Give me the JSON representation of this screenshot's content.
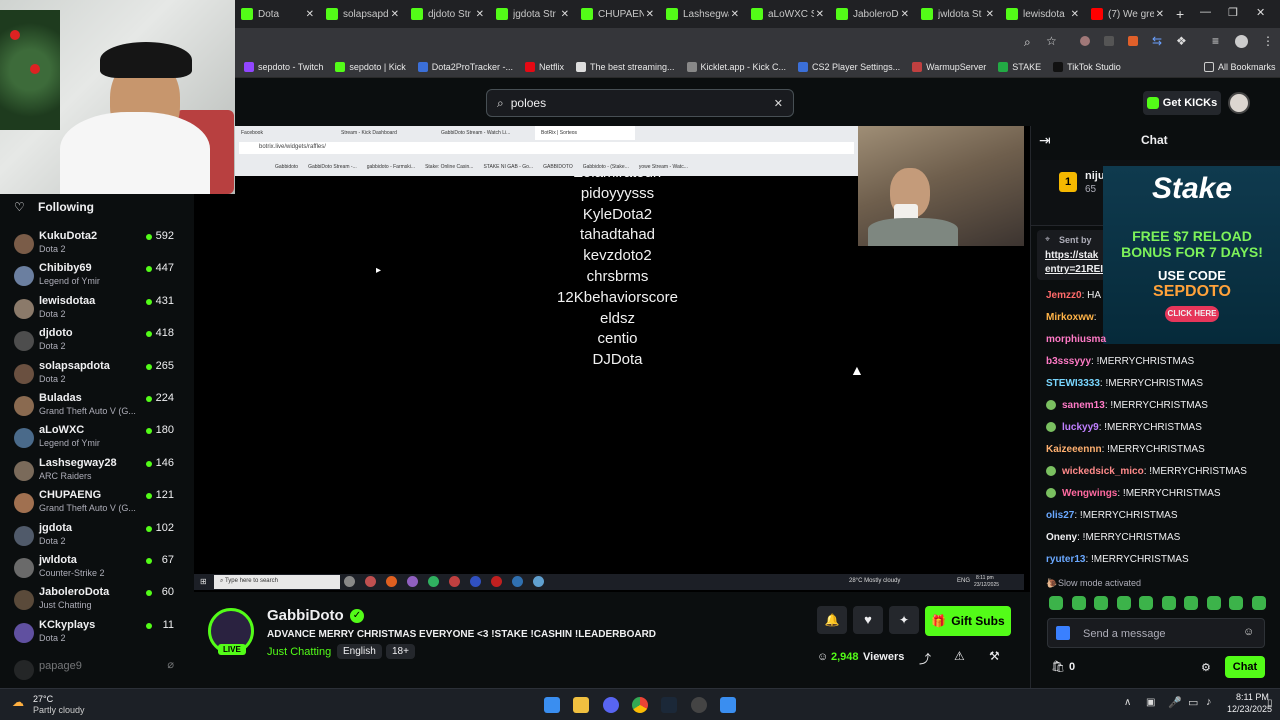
{
  "browser": {
    "tabs": [
      {
        "label": "Dota",
        "color": "#53fc18"
      },
      {
        "label": "solapsapd",
        "color": "#53fc18"
      },
      {
        "label": "djdoto Str",
        "color": "#53fc18"
      },
      {
        "label": "jgdota Str",
        "color": "#53fc18"
      },
      {
        "label": "CHUPAEN",
        "color": "#53fc18"
      },
      {
        "label": "Lashsegwa",
        "color": "#53fc18"
      },
      {
        "label": "aLoWXC S",
        "color": "#53fc18"
      },
      {
        "label": "JaboleroD",
        "color": "#53fc18"
      },
      {
        "label": "jwldota St",
        "color": "#53fc18"
      },
      {
        "label": "lewisdota",
        "color": "#53fc18"
      },
      {
        "label": "(7) We gre",
        "color": "#ff0000"
      }
    ],
    "new_tab": "+",
    "bookmarks": [
      {
        "label": "sepdoto - Twitch",
        "color": "#9146ff"
      },
      {
        "label": "sepdoto | Kick",
        "color": "#53fc18"
      },
      {
        "label": "Dota2ProTracker -...",
        "color": "#3b6fd8"
      },
      {
        "label": "Netflix",
        "color": "#e50914"
      },
      {
        "label": "The best streaming...",
        "color": "#dddddd"
      },
      {
        "label": "Kicklet.app - Kick C...",
        "color": "#888888"
      },
      {
        "label": "CS2 Player Settings...",
        "color": "#3b6fd8"
      },
      {
        "label": "WarmupServer",
        "color": "#c04040"
      },
      {
        "label": "STAKE",
        "color": "#22aa44"
      },
      {
        "label": "TikTok Studio",
        "color": "#111111"
      }
    ],
    "all_bookmarks": "All Bookmarks"
  },
  "header": {
    "search_value": "poloes",
    "get_kicks": "Get KICKs"
  },
  "sidebar": {
    "title": "Following",
    "channels": [
      {
        "name": "KukuDota2",
        "game": "Dota 2",
        "viewers": "592",
        "color": "#7a5c48"
      },
      {
        "name": "Chibiby69",
        "game": "Legend of Ymir",
        "viewers": "447",
        "color": "#6b7fa0"
      },
      {
        "name": "lewisdotaa",
        "game": "Dota 2",
        "viewers": "431",
        "color": "#8b7a6a"
      },
      {
        "name": "djdoto",
        "game": "Dota 2",
        "viewers": "418",
        "color": "#4d4d4d"
      },
      {
        "name": "solapsapdota",
        "game": "Dota 2",
        "viewers": "265",
        "color": "#6a5040"
      },
      {
        "name": "Buladas",
        "game": "Grand Theft Auto V (G...",
        "viewers": "224",
        "color": "#8a6a50"
      },
      {
        "name": "aLoWXC",
        "game": "Legend of Ymir",
        "viewers": "180",
        "color": "#4a6a8a"
      },
      {
        "name": "Lashsegway28",
        "game": "ARC Raiders",
        "viewers": "146",
        "color": "#7a6a5a"
      },
      {
        "name": "CHUPAENG",
        "game": "Grand Theft Auto V (G...",
        "viewers": "121",
        "color": "#a07050"
      },
      {
        "name": "jgdota",
        "game": "Dota 2",
        "viewers": "102",
        "color": "#505a6a"
      },
      {
        "name": "jwldota",
        "game": "Counter-Strike 2",
        "viewers": "67",
        "color": "#6a6a6a"
      },
      {
        "name": "JaboleroDota",
        "game": "Just Chatting",
        "viewers": "60",
        "color": "#5a4a3a"
      },
      {
        "name": "KCkyplays",
        "game": "Dota 2",
        "viewers": "11",
        "color": "#6050a0"
      }
    ],
    "offline_name": "papage9"
  },
  "player": {
    "inner_tabs": [
      "Facebook",
      "Stream - Kick Dashboard",
      "GabbiDoto Stream - Watch Li...",
      "BotRix | Sorteos"
    ],
    "inner_url": "botrix.live/widgets/raffles/",
    "inner_bookmarks": [
      "Gabbidoto",
      "GabbiDoto Stream -...",
      "gabbidoto - Farmski...",
      "Stake: Online Casin...",
      "STAKE NI GAB - Go...",
      "GABBIDOTO",
      "Gabbidoto - (Stake...",
      "yowe Stream - Watc..."
    ],
    "raffle_names": [
      "Zolamiratouri",
      "pidoyyysss",
      "KyleDota2",
      "tahadtahad",
      "kevzdoto2",
      "chrsbrms",
      "12Kbehaviorscore",
      "eldsz",
      "centio",
      "DJDota"
    ],
    "inner_taskbar_search": "Type here to search",
    "inner_weather": "28°C  Mostly cloudy",
    "inner_lang": "ENG",
    "inner_time": "8:11 pm",
    "inner_date": "23/12/2025"
  },
  "stream": {
    "name": "GabbiDoto",
    "title": "ADVANCE MERRY CHRISTMAS EVERYONE <3 !STAKE !CASHIN !LEADERBOARD",
    "category": "Just Chatting",
    "tags": [
      "English",
      "18+"
    ],
    "live": "LIVE",
    "viewers": "2,948",
    "viewers_label": "Viewers",
    "gift_subs": "Gift Subs"
  },
  "chat": {
    "title": "Chat",
    "leaderboard_name": "nijur",
    "leaderboard_count": "65",
    "pinned_sender": "Sent by",
    "pinned_link_1": "https://stak",
    "pinned_link_2": "entry=21REI",
    "ad": {
      "brand": "Stake",
      "line1": "FREE $7 RELOAD",
      "line2": "BONUS FOR 7 DAYS!",
      "line3": "USE CODE",
      "code": "SEPDOTO",
      "cta": "CLICK HERE"
    },
    "messages": [
      {
        "user": "Jemzz0",
        "text": ": HA",
        "color": "#ff6a6a",
        "badge": false
      },
      {
        "user": "Mirkoxww",
        "text": ":",
        "color": "#ffb347",
        "badge": false
      },
      {
        "user": "morphiusma",
        "text": "",
        "color": "#ff7ac6",
        "badge": false
      },
      {
        "user": "b3sssyyy",
        "text": ": !MERRYCHRISTMAS",
        "color": "#ff7ac6",
        "badge": false
      },
      {
        "user": "STEWI3333",
        "text": ": !MERRYCHRISTMAS",
        "color": "#7ad7ff",
        "badge": false
      },
      {
        "user": "sanem13",
        "text": ": !MERRYCHRISTMAS",
        "color": "#ff7ac6",
        "badge": true
      },
      {
        "user": "luckyy9",
        "text": ": !MERRYCHRISTMAS",
        "color": "#c080ff",
        "badge": true
      },
      {
        "user": "Kaizeeennn",
        "text": ": !MERRYCHRISTMAS",
        "color": "#ffb070",
        "badge": false
      },
      {
        "user": "wickedsick_mico",
        "text": ": !MERRYCHRISTMAS",
        "color": "#ff8a8a",
        "badge": true
      },
      {
        "user": "Wengwings",
        "text": ": !MERRYCHRISTMAS",
        "color": "#ff6aa0",
        "badge": true
      },
      {
        "user": "olis27",
        "text": ": !MERRYCHRISTMAS",
        "color": "#6aa8ff",
        "badge": false
      },
      {
        "user": "Oneny",
        "text": ": !MERRYCHRISTMAS",
        "color": "#efeff1",
        "badge": false
      },
      {
        "user": "ryuter13",
        "text": ": !MERRYCHRISTMAS",
        "color": "#6aa8ff",
        "badge": false
      }
    ],
    "slow_mode": "Slow mode activated",
    "placeholder": "Send a message",
    "points": "0",
    "send": "Chat"
  },
  "taskbar": {
    "temp": "27°C",
    "weather": "Partly cloudy",
    "time": "8:11 PM",
    "date": "12/23/2025"
  }
}
